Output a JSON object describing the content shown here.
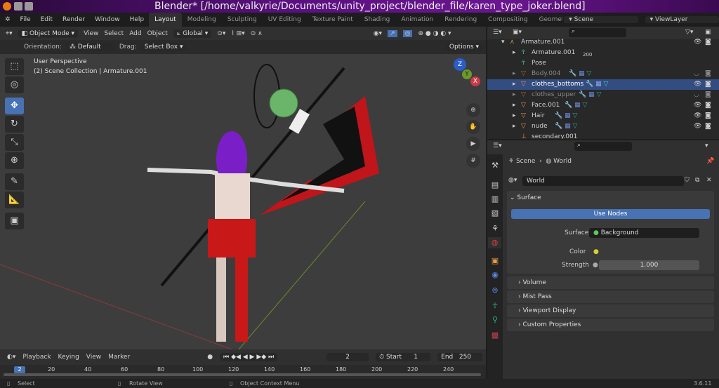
{
  "title_bar": {
    "title": "Blender* [/home/valkyrie/Documents/unity_project/blender_file/karen_type_joker.blend]"
  },
  "menu": [
    "File",
    "Edit",
    "Render",
    "Window",
    "Help"
  ],
  "workspaces": [
    "Layout",
    "Modeling",
    "Sculpting",
    "UV Editing",
    "Texture Paint",
    "Shading",
    "Animation",
    "Rendering",
    "Compositing",
    "Geometry Noc"
  ],
  "scene": {
    "name": "Scene",
    "view_layer": "ViewLayer"
  },
  "viewport_header": {
    "mode": "Object Mode",
    "items": [
      "View",
      "Select",
      "Add",
      "Object"
    ],
    "transform": "Global"
  },
  "tool_settings": {
    "orientation_label": "Orientation:",
    "orientation": "Default",
    "drag_label": "Drag:",
    "drag": "Select Box",
    "options": "Options"
  },
  "viewport": {
    "perspective": "User Perspective",
    "collection": "(2) Scene Collection | Armature.001",
    "gizmo": {
      "x": "X",
      "y": "Y",
      "z": "Z"
    }
  },
  "outliner": {
    "items": [
      {
        "name": "Armature.001",
        "badge": ""
      },
      {
        "name": "Armature.001",
        "badge": "200"
      },
      {
        "name": "Pose"
      },
      {
        "name": "Body.004"
      },
      {
        "name": "clothes_bottoms"
      },
      {
        "name": "clothes_upper"
      },
      {
        "name": "Face.001"
      },
      {
        "name": "Hair"
      },
      {
        "name": "nude"
      },
      {
        "name": "secondary.001"
      }
    ]
  },
  "properties": {
    "breadcrumb": {
      "scene": "Scene",
      "world": "World"
    },
    "world_name": "World",
    "surface_panel": "Surface",
    "use_nodes": "Use Nodes",
    "surface_label": "Surface",
    "surface_value": "Background",
    "color_label": "Color",
    "strength_label": "Strength",
    "strength_value": "1.000",
    "panels": [
      "Volume",
      "Mist Pass",
      "Viewport Display",
      "Custom Properties"
    ]
  },
  "timeline": {
    "menus": [
      "Playback",
      "Keying",
      "View",
      "Marker"
    ],
    "current_frame": "2",
    "start_label": "Start",
    "start": "1",
    "end_label": "End",
    "end": "250",
    "ticks": [
      "20",
      "40",
      "60",
      "80",
      "100",
      "120",
      "140",
      "160",
      "180",
      "200",
      "220",
      "240"
    ]
  },
  "status_bar": {
    "select": "Select",
    "rotate": "Rotate View",
    "context": "Object Context Menu",
    "version": "3.6.11"
  }
}
